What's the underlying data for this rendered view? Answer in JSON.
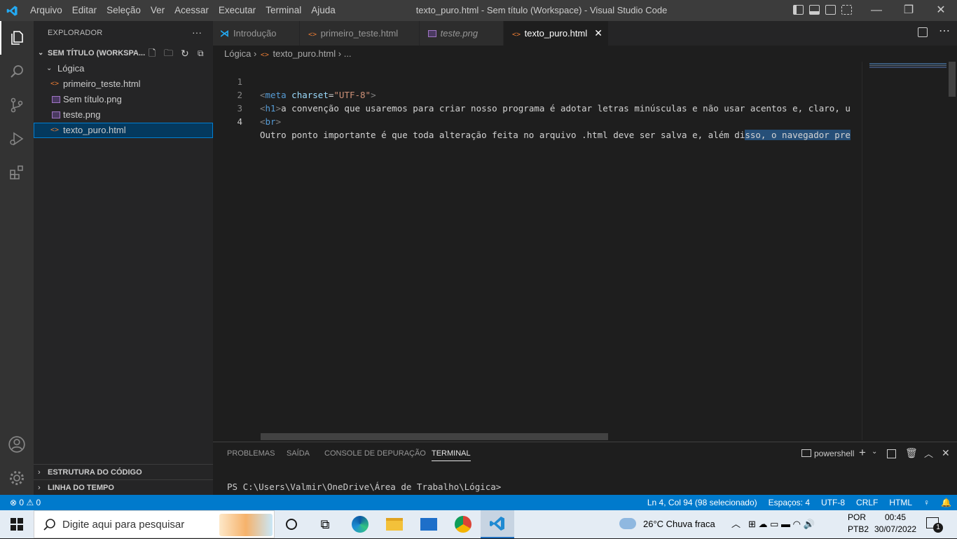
{
  "titlebar": {
    "menu": [
      "Arquivo",
      "Editar",
      "Seleção",
      "Ver",
      "Acessar",
      "Executar",
      "Terminal",
      "Ajuda"
    ],
    "window_title": "texto_puro.html - Sem título (Workspace) - Visual Studio Code"
  },
  "sidebar": {
    "header": "EXPLORADOR",
    "more": "···",
    "workspace": "SEM TÍTULO (WORKSPA...",
    "folder": "Lógica",
    "files": [
      {
        "name": "primeiro_teste.html",
        "icon": "html-file-icon"
      },
      {
        "name": "Sem título.png",
        "icon": "image-file-icon"
      },
      {
        "name": "teste.png",
        "icon": "image-file-icon"
      },
      {
        "name": "texto_puro.html",
        "icon": "html-file-icon"
      }
    ],
    "outline": "ESTRUTURA DO CÓDIGO",
    "timeline": "LINHA DO TEMPO"
  },
  "tabs": [
    {
      "label": "Introdução",
      "icon": "vscode-icon"
    },
    {
      "label": "primeiro_teste.html",
      "icon": "html-file-icon"
    },
    {
      "label": "teste.png",
      "icon": "image-file-icon"
    },
    {
      "label": "texto_puro.html",
      "icon": "html-file-icon",
      "close": "✕"
    }
  ],
  "breadcrumb": {
    "folder": "Lógica",
    "file": "texto_puro.html",
    "more": "..."
  },
  "editor": {
    "line_numbers": [
      "1",
      "2",
      "3",
      "4"
    ],
    "line1": {
      "open": "<",
      "tag": "meta",
      "attr": "charset",
      "eq": "=",
      "value": "\"UTF-8\"",
      "close": ">"
    },
    "line2": {
      "open": "<",
      "tag": "h1",
      "close": ">",
      "text": "a convenção que usaremos para criar nosso programa é adotar letras minúsculas e não usar acentos e, claro, u"
    },
    "line3": {
      "open": "<",
      "tag": "br",
      "close": ">"
    },
    "line4": {
      "text": "Outro ponto importante é que toda alteração feita no arquivo .html deve ser salva e, além di",
      "selected": "sso, o navegador pre"
    }
  },
  "panel": {
    "tabs": [
      "PROBLEMAS",
      "SAÍDA",
      "CONSOLE DE DEPURAÇÃO",
      "TERMINAL"
    ],
    "shell": "powershell",
    "prompt": "PS C:\\Users\\Valmir\\OneDrive\\Área de Trabalho\\Lógica>"
  },
  "statusbar": {
    "errors": "0",
    "warnings": "0",
    "position": "Ln 4, Col 94 (98 selecionado)",
    "spaces": "Espaços: 4",
    "encoding": "UTF-8",
    "eol": "CRLF",
    "language": "HTML"
  },
  "taskbar": {
    "search_placeholder": "Digite aqui para pesquisar",
    "weather": "26°C  Chuva fraca",
    "lang_top": "POR",
    "lang_bottom": "PTB2",
    "time": "00:45",
    "date": "30/07/2022",
    "notifications": "1"
  },
  "colors": {
    "accent": "#007acc",
    "tag": "#569cd6",
    "attr": "#9cdcfe",
    "string": "#ce9178"
  }
}
